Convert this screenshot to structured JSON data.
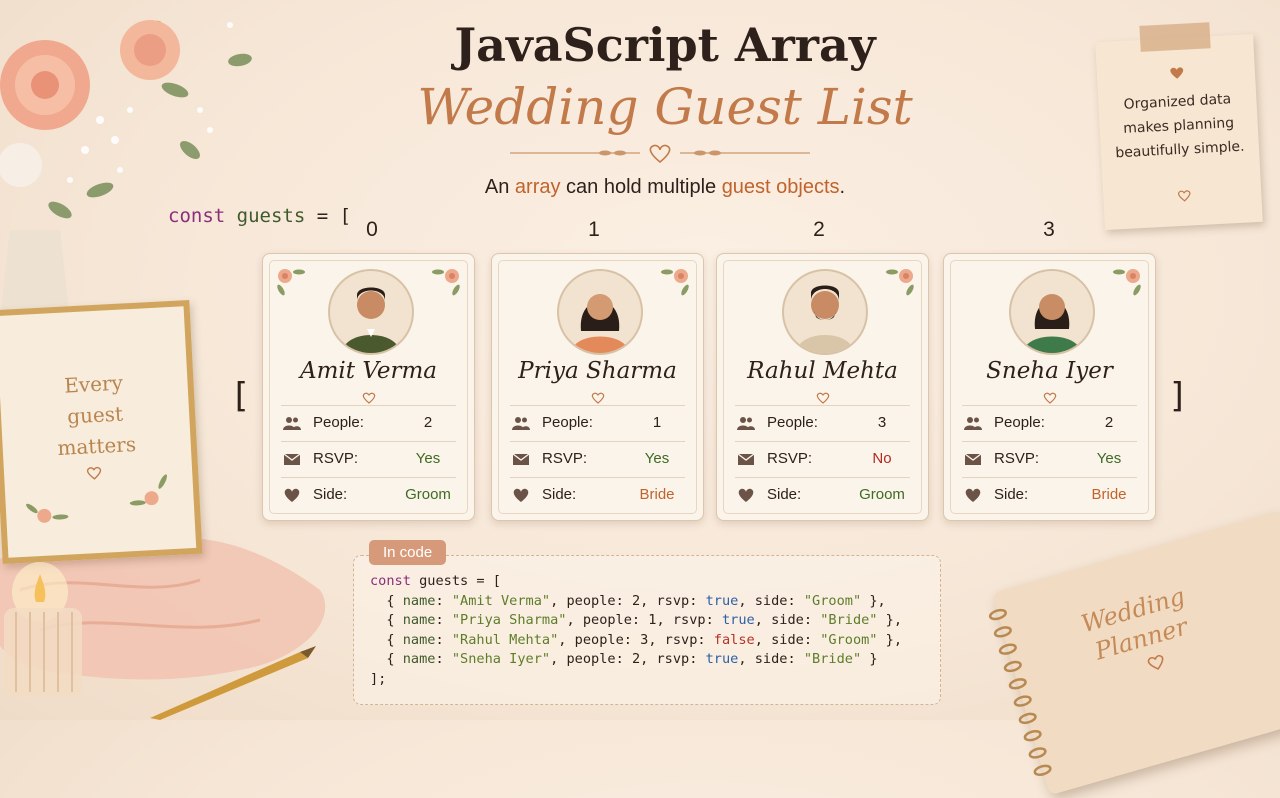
{
  "title": {
    "main": "JavaScript Array",
    "script": "Wedding Guest List"
  },
  "subtitle": {
    "prefix": "An ",
    "word1": "array",
    "middle": " can hold multiple ",
    "word2": "guest objects",
    "suffix": "."
  },
  "code_header": {
    "keyword": "const",
    "var": "guests",
    "rest": " = ["
  },
  "brackets": {
    "open": "[",
    "close": "]"
  },
  "labels": {
    "people": "People:",
    "rsvp": "RSVP:",
    "side": "Side:"
  },
  "guests": [
    {
      "index": "0",
      "name": "Amit Verma",
      "people": "2",
      "rsvp": "Yes",
      "side": "Groom"
    },
    {
      "index": "1",
      "name": "Priya Sharma",
      "people": "1",
      "rsvp": "Yes",
      "side": "Bride"
    },
    {
      "index": "2",
      "name": "Rahul Mehta",
      "people": "3",
      "rsvp": "No",
      "side": "Groom"
    },
    {
      "index": "3",
      "name": "Sneha Iyer",
      "people": "2",
      "rsvp": "Yes",
      "side": "Bride"
    }
  ],
  "note": {
    "text": "Organized data makes planning beautifully simple."
  },
  "frame": {
    "line1": "Every",
    "line2": "guest",
    "line3": "matters"
  },
  "code_box": {
    "tag": "In code",
    "line_open_kw": "const",
    "line_open_rest": " guests = [",
    "line_close": "];",
    "rows": [
      {
        "name": "\"Amit Verma\"",
        "people": "2",
        "rsvp": "true",
        "side": "\"Groom\"",
        "end": " },"
      },
      {
        "name": "\"Priya Sharma\"",
        "people": "1",
        "rsvp": "true",
        "side": "\"Bride\"",
        "end": " },"
      },
      {
        "name": "\"Rahul Mehta\"",
        "people": "3",
        "rsvp": "false",
        "side": "\"Groom\"",
        "end": " },"
      },
      {
        "name": "\"Sneha Iyer\"",
        "people": "2",
        "rsvp": "true",
        "side": "\"Bride\"",
        "end": " }"
      }
    ]
  },
  "planner": {
    "line1": "Wedding",
    "line2": "Planner"
  },
  "colors": {
    "accent": "#c27a4a",
    "green": "#3f6b22",
    "red": "#b22a20",
    "orange": "#c0632c"
  }
}
